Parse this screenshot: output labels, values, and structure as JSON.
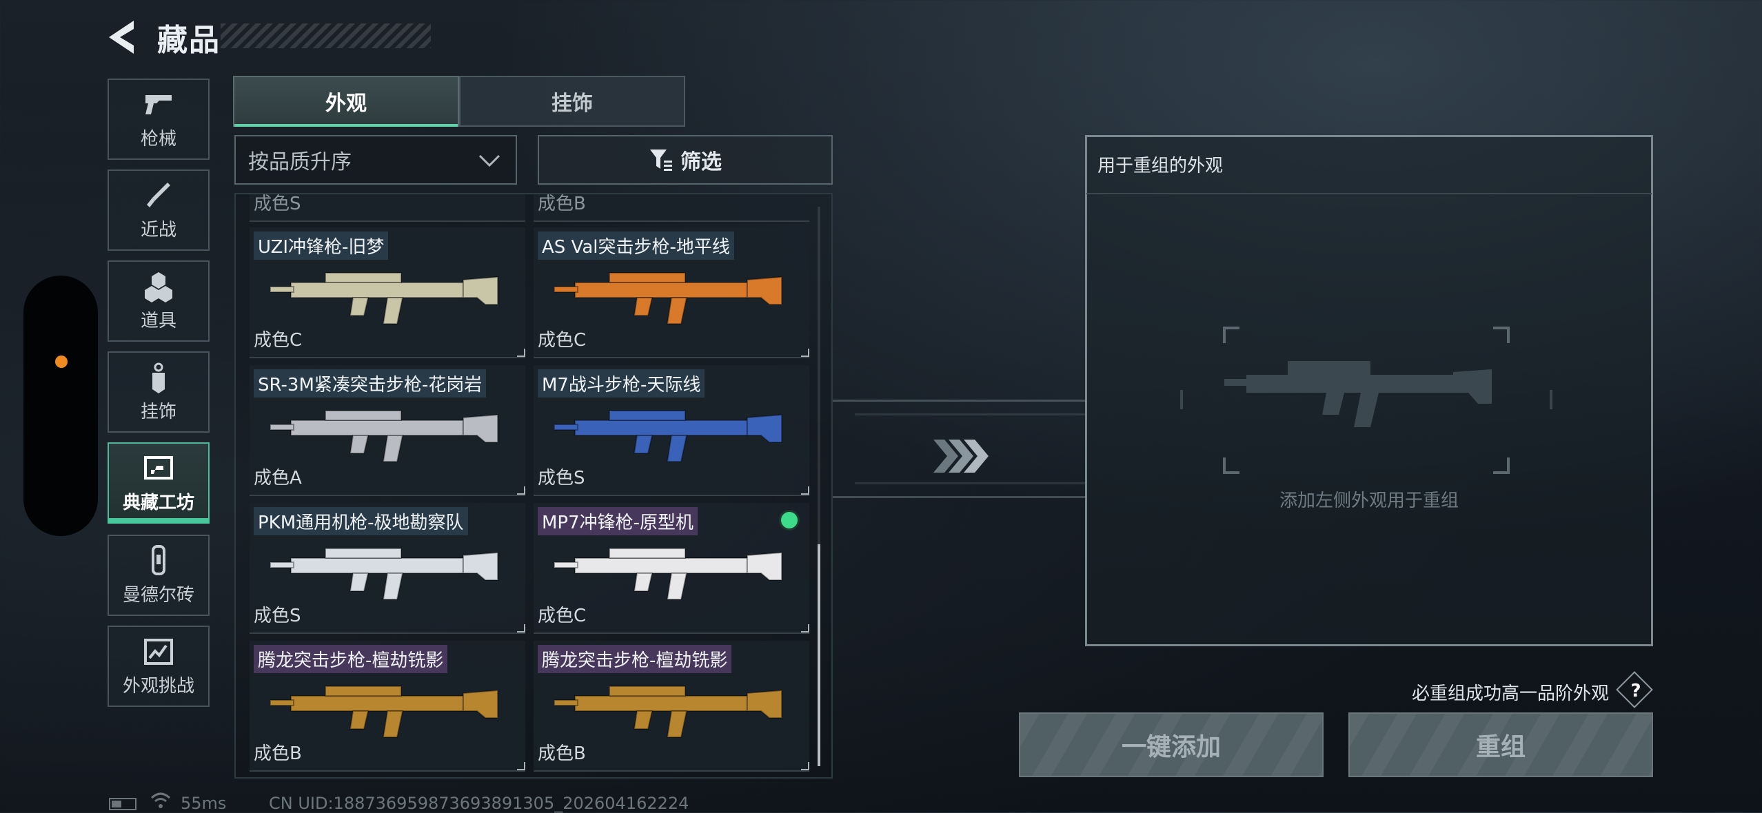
{
  "header": {
    "title": "藏品",
    "back_icon": "back-arrow-icon"
  },
  "sidebar": {
    "items": [
      {
        "label": "枪械",
        "icon": "pistol-icon",
        "active": false
      },
      {
        "label": "近战",
        "icon": "knife-icon",
        "active": false
      },
      {
        "label": "道具",
        "icon": "grenades-icon",
        "active": false
      },
      {
        "label": "挂饰",
        "icon": "charm-tag-icon",
        "active": false
      },
      {
        "label": "典藏工坊",
        "icon": "workshop-icon",
        "active": true
      },
      {
        "label": "曼德尔砖",
        "icon": "brick-icon",
        "active": false
      },
      {
        "label": "外观挑战",
        "icon": "challenge-map-icon",
        "active": false
      }
    ]
  },
  "tabs": [
    {
      "label": "外观",
      "active": true
    },
    {
      "label": "挂饰",
      "active": false
    }
  ],
  "toolbar": {
    "sort_value": "按品质升序",
    "filter_label": "筛选"
  },
  "grid": {
    "partial_top": [
      "成色S",
      "成色B"
    ],
    "items": [
      {
        "name": "UZI冲锋枪-旧梦",
        "grade": "成色C",
        "tag_color": "blue",
        "equipped": false,
        "gun_color": "#c9c6a8"
      },
      {
        "name": "AS Val突击步枪-地平线",
        "grade": "成色C",
        "tag_color": "blue",
        "equipped": false,
        "gun_color": "#d97a2a"
      },
      {
        "name": "SR-3M紧凑突击步枪-花岗岩",
        "grade": "成色A",
        "tag_color": "blue",
        "equipped": false,
        "gun_color": "#b9bcc2"
      },
      {
        "name": "M7战斗步枪-天际线",
        "grade": "成色S",
        "tag_color": "blue",
        "equipped": false,
        "gun_color": "#3a62b8"
      },
      {
        "name": "PKM通用机枪-极地勘察队",
        "grade": "成色S",
        "tag_color": "blue",
        "equipped": false,
        "gun_color": "#d8dde4"
      },
      {
        "name": "MP7冲锋枪-原型机",
        "grade": "成色C",
        "tag_color": "purple",
        "equipped": true,
        "gun_color": "#e8e8ea"
      },
      {
        "name": "腾龙突击步枪-檀劫铣影",
        "grade": "成色B",
        "tag_color": "purple",
        "equipped": false,
        "gun_color": "#b8862f"
      },
      {
        "name": "腾龙突击步枪-檀劫铣影",
        "grade": "成色B",
        "tag_color": "purple",
        "equipped": false,
        "gun_color": "#b8862f"
      }
    ]
  },
  "recombine": {
    "panel_title": "用于重组的外观",
    "hint": "添加左侧外观用于重组",
    "guarantee_text": "必重组成功高一品阶外观",
    "help_label": "?",
    "add_all_label": "一键添加",
    "recombine_label": "重组"
  },
  "status": {
    "ping": "55ms",
    "uid": "CN UID:188736959873693891305_202604162224"
  },
  "colors": {
    "accent_green": "#48c79c",
    "equipped_dot": "#3cdc8a",
    "notification_dot": "#f28a22"
  }
}
